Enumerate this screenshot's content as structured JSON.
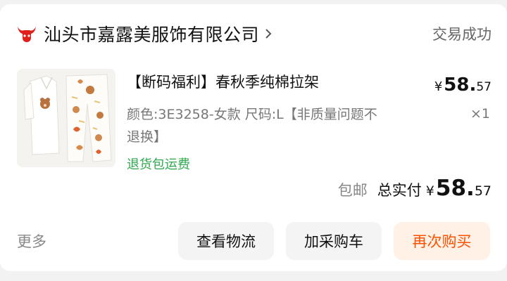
{
  "shop": {
    "name": "汕头市嘉露美服饰有限公司",
    "logo_icon": "red-bull-logo-icon",
    "chevron_icon": "chevron-right-icon",
    "status": "交易成功"
  },
  "item": {
    "title": "【断码福利】春秋季纯棉拉架",
    "spec": "颜色:3E3258-女款 尺码:L【非质量问题不退换】",
    "tag": "退货包运费",
    "price_symbol": "¥",
    "price_int": "58.",
    "price_dec": "57",
    "quantity": "×1",
    "image_icon": "pajamas-product-image"
  },
  "total": {
    "shipping": "包邮",
    "label": "总实付",
    "symbol": "¥",
    "int": "58.",
    "dec": "57"
  },
  "actions": {
    "more": "更多",
    "logistics": "查看物流",
    "add_cart": "加采购车",
    "rebuy": "再次购买"
  },
  "colors": {
    "accent": "#ff5000",
    "tag_green": "#2ea84d",
    "logo_red": "#e0201c"
  }
}
